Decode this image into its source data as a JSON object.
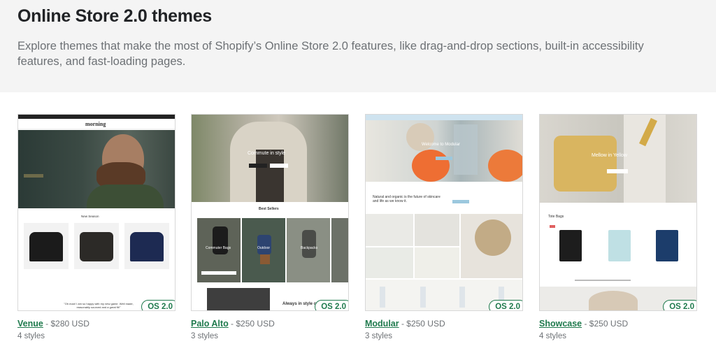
{
  "hero": {
    "title": "Online Store 2.0 themes",
    "description": "Explore themes that make the most of Shopify’s Online Store 2.0 features, like drag-and-drop sections, built-in accessibility features, and fast-loading pages."
  },
  "themes": [
    {
      "name": "Venue",
      "price": " - $280 USD",
      "styles": "4 styles",
      "badge": "OS 2.0",
      "preview": {
        "brand": "morning",
        "heading": "New Season",
        "quote": "\"Oh man! I am so happy with my new game. Well made, reasonably sourced and a great fit!\""
      }
    },
    {
      "name": "Palo Alto",
      "price": " - $250 USD",
      "styles": "3 styles",
      "badge": "OS 2.0",
      "preview": {
        "hero_text": "Commute in style",
        "heading": "Best Sellers",
        "tiles": [
          "Commuter Bags",
          "Outdoor",
          "Backpacks"
        ],
        "footer_text": "Always in style on"
      }
    },
    {
      "name": "Modular",
      "price": " - $250 USD",
      "styles": "3 styles",
      "badge": "OS 2.0",
      "preview": {
        "hero_text": "Welcome to Modular",
        "heading": "Natural and organic is the future of skincare and life as we know it."
      }
    },
    {
      "name": "Showcase",
      "price": " - $250 USD",
      "styles": "4 styles",
      "badge": "OS 2.0",
      "preview": {
        "hero_text": "Mellow in Yellow",
        "heading": "Tote Bags"
      }
    }
  ],
  "colors": {
    "accent": "#1f7a4d",
    "hero_bg": "#f4f4f4"
  }
}
